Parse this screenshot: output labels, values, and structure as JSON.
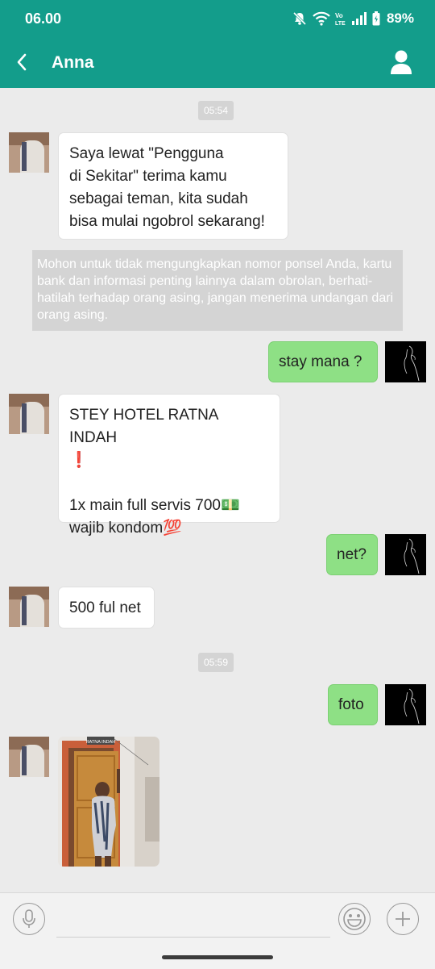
{
  "status_bar": {
    "time": "06.00",
    "battery": "89%",
    "icons": [
      "mute-icon",
      "wifi-icon",
      "volte-icon",
      "signal-icon",
      "battery-icon"
    ]
  },
  "header": {
    "title": "Anna",
    "back_icon": "chevron-left-icon",
    "profile_icon": "user-icon"
  },
  "colors": {
    "brand": "#139d8b",
    "outgoing_bubble": "#8ee085",
    "incoming_bubble": "#ffffff",
    "chat_background": "#ebebeb",
    "system_notice": "#d4d4d4"
  },
  "messages": [
    {
      "type": "timestamp",
      "text": "05:54"
    },
    {
      "type": "incoming",
      "lines": [
        "Saya lewat \"Pengguna",
        "di Sekitar\" terima kamu",
        "sebagai teman, kita sudah",
        "bisa mulai ngobrol sekarang!"
      ]
    },
    {
      "type": "notice",
      "text": "Mohon untuk tidak  mengungkapkan nomor ponsel Anda, kartu bank dan informasi penting lainnya dalam obrolan, berhati-hatilah terhadap orang asing, jangan menerima undangan dari orang asing."
    },
    {
      "type": "outgoing",
      "text": "stay mana ?"
    },
    {
      "type": "incoming",
      "lines": [
        "STEY HOTEL RATNA INDAH",
        "❗",
        "",
        "1x main full servis 700💵",
        "wajib kondom💯"
      ]
    },
    {
      "type": "outgoing",
      "text": "net?"
    },
    {
      "type": "incoming",
      "text": "500 ful net"
    },
    {
      "type": "timestamp",
      "text": "05:59"
    },
    {
      "type": "outgoing",
      "text": "foto"
    },
    {
      "type": "incoming-photo",
      "sign_text": "RATNA INDAH"
    }
  ],
  "input_bar": {
    "voice_icon": "microphone-icon",
    "emoji_icon": "smiley-icon",
    "add_icon": "plus-icon",
    "placeholder": ""
  }
}
